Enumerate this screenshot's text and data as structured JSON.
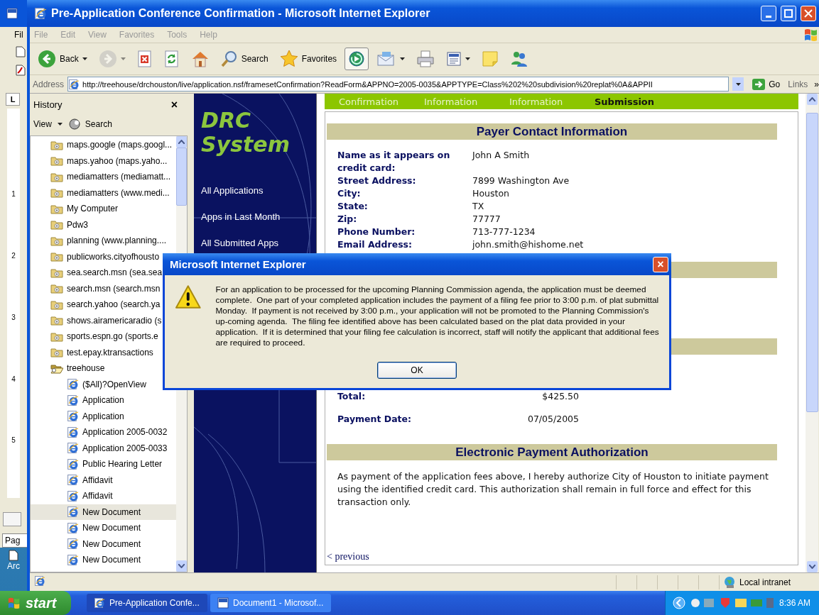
{
  "background_window": {
    "menu_item": "Fil",
    "tab_stop": "L",
    "ruler_marks": [
      "1",
      "2",
      "3",
      "4",
      "5"
    ],
    "status_text": "Pag"
  },
  "desktop_icon": {
    "label": "Arc"
  },
  "window": {
    "title": "Pre-Application Conference Confirmation - Microsoft Internet Explorer",
    "menu": [
      "File",
      "Edit",
      "View",
      "Favorites",
      "Tools",
      "Help"
    ],
    "toolbar": [
      {
        "kind": "back",
        "label": "Back",
        "dropdown": true,
        "disabled": false,
        "selected": false
      },
      {
        "kind": "forward",
        "dropdown": true,
        "disabled": true,
        "selected": false
      },
      {
        "kind": "stop",
        "dropdown": false,
        "disabled": false,
        "selected": false
      },
      {
        "kind": "refresh",
        "dropdown": false,
        "disabled": false,
        "selected": false
      },
      {
        "kind": "home",
        "dropdown": false,
        "disabled": false,
        "selected": false
      },
      {
        "kind": "search",
        "label": "Search",
        "dropdown": false,
        "disabled": false,
        "selected": false
      },
      {
        "kind": "favorites",
        "label": "Favorites",
        "dropdown": false,
        "disabled": false,
        "selected": false
      },
      {
        "kind": "media",
        "dropdown": false,
        "disabled": false,
        "selected": true
      },
      {
        "kind": "mail",
        "dropdown": true,
        "disabled": false,
        "selected": false
      },
      {
        "kind": "print",
        "dropdown": false,
        "disabled": false,
        "selected": false
      },
      {
        "kind": "edit",
        "dropdown": true,
        "disabled": false,
        "selected": false
      },
      {
        "kind": "notes",
        "dropdown": false,
        "disabled": false,
        "selected": false
      },
      {
        "kind": "messenger",
        "dropdown": false,
        "disabled": false,
        "selected": false
      }
    ],
    "address": {
      "label": "Address",
      "value": "http://treehouse/drchouston/live/application.nsf/framesetConfirmation?ReadForm&APPNO=2005-0035&APPTYPE=Class%202%20subdivision%20replat%0A&APPII",
      "go": "Go",
      "links": "Links",
      "links_more": "»"
    }
  },
  "history": {
    "title": "History",
    "close": "×",
    "view": "View",
    "search": "Search",
    "items": [
      {
        "label": "maps.google (maps.googl...",
        "selected": false
      },
      {
        "label": "maps.yahoo (maps.yaho...",
        "selected": false
      },
      {
        "label": "mediamatters (mediamatt...",
        "selected": false
      },
      {
        "label": "mediamatters (www.medi...",
        "selected": false
      },
      {
        "label": "My Computer",
        "selected": false
      },
      {
        "label": "Pdw3",
        "selected": false
      },
      {
        "label": "planning (www.planning....",
        "selected": false
      },
      {
        "label": "publicworks.cityofhousto",
        "selected": false
      },
      {
        "label": "sea.search.msn (sea.sea",
        "selected": false
      },
      {
        "label": "search.msn (search.msn",
        "selected": false
      },
      {
        "label": "search.yahoo (search.ya",
        "selected": false
      },
      {
        "label": "shows.airamericaradio (s",
        "selected": false
      },
      {
        "label": "sports.espn.go (sports.e",
        "selected": false
      },
      {
        "label": "test.epay.ktransactions",
        "selected": false
      },
      {
        "label": "treehouse",
        "selected": false,
        "expanded": true,
        "children": [
          {
            "label": "($All)?OpenView",
            "selected": false
          },
          {
            "label": "Application",
            "selected": false
          },
          {
            "label": "Application",
            "selected": false
          },
          {
            "label": "Application 2005-0032",
            "selected": false
          },
          {
            "label": "Application 2005-0033",
            "selected": false
          },
          {
            "label": "Public Hearing Letter",
            "selected": false
          },
          {
            "label": "Affidavit",
            "selected": false
          },
          {
            "label": "Affidavit",
            "selected": false
          },
          {
            "label": "New Document",
            "selected": true
          },
          {
            "label": "New Document",
            "selected": false
          },
          {
            "label": "New Document",
            "selected": false
          },
          {
            "label": "New Document",
            "selected": false
          }
        ]
      }
    ]
  },
  "nav": {
    "logo": [
      "DRC",
      "System"
    ],
    "links": [
      "All Applications",
      "Apps in Last Month",
      "All Submitted Apps"
    ]
  },
  "steps": [
    {
      "label": "Confirmation",
      "selected": false
    },
    {
      "label": "Information",
      "selected": false
    },
    {
      "label": "Information",
      "selected": false
    },
    {
      "label": "Submission",
      "selected": true
    }
  ],
  "payer": {
    "title": "Payer Contact Information",
    "fields": [
      {
        "label": "Name as it appears on credit card:",
        "value": "John A Smith"
      },
      {
        "label": "Street Address:",
        "value": "7899 Washington Ave"
      },
      {
        "label": "City:",
        "value": "Houston"
      },
      {
        "label": "State:",
        "value": "TX"
      },
      {
        "label": "Zip:",
        "value": "77777"
      },
      {
        "label": "Phone Number:",
        "value": "713-777-1234"
      },
      {
        "label": "Email Address:",
        "value": "john.smith@hishome.net"
      }
    ]
  },
  "totals": [
    {
      "label": "Total:",
      "value": "$425.50"
    },
    {
      "label": "Payment Date:",
      "value": "07/05/2005"
    }
  ],
  "authorization": {
    "title": "Electronic Payment Authorization",
    "text": "As payment of the application fees above, I hereby authorize City of Houston to initiate payment using the identified credit card. This authorization shall remain in full force and effect for this transaction only."
  },
  "previous_link": "< previous",
  "status_bar": {
    "zone": "Local intranet"
  },
  "dialog": {
    "title": "Microsoft Internet Explorer",
    "close": "×",
    "message": "For an application to be processed for the upcoming Planning Commission agenda, the application must be deemed complete.  One part of your completed application includes the payment of a filing fee prior to 3:00 p.m. of plat submittal Monday.  If payment is not received by 3:00 p.m., your application will not be promoted to the Planning Commission's up-coming agenda.  The filing fee identified above has been calculated based on the plat data provided in your application.  If it is determined that your filing fee calculation is incorrect, staff will notify the applicant that additional fees are required to proceed.",
    "buttons": [
      "OK"
    ]
  },
  "taskbar": {
    "start": "start",
    "tasks": [
      {
        "kind": "browser",
        "label": "Pre-Application Confe...",
        "selected": true
      },
      {
        "kind": "document",
        "label": "Document1 - Microsof...",
        "selected": false
      }
    ],
    "clock": "8:36 AM"
  }
}
